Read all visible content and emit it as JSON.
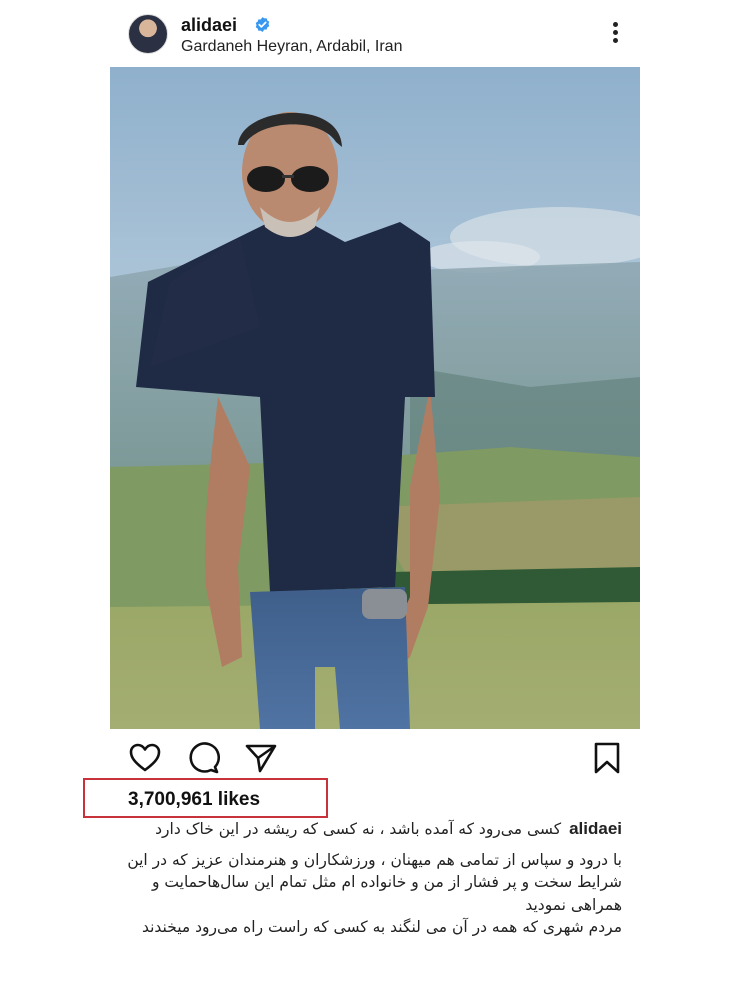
{
  "post": {
    "username": "alidaei",
    "location": "Gardaneh Heyran, Ardabil, Iran",
    "likes": "3,700,961 likes",
    "caption_user": "alidaei",
    "caption_lines": [
      "کسی می‌رود که آمده باشد ، نه کسی که ریشه در این خاک دارد",
      "با درود و سپاس از تمامی هم میهنان ، ورزشکاران و هنرمندان عزیز که در این شرایط سخت و پر فشار از من و خانواده ام  مثل تمام این سال‌هاحمایت و همراهی نمودید",
      "مردم شهری که همه در آن می لنگند به کسی که راست راه می‌رود میخندند"
    ]
  },
  "icons": {
    "verified": "verified-badge-icon",
    "more": "more-options-icon",
    "like": "heart-icon",
    "comment": "comment-icon",
    "share": "send-icon",
    "save": "bookmark-icon"
  },
  "colors": {
    "verified_blue": "#3897f0",
    "highlight_red": "#c8323b"
  }
}
